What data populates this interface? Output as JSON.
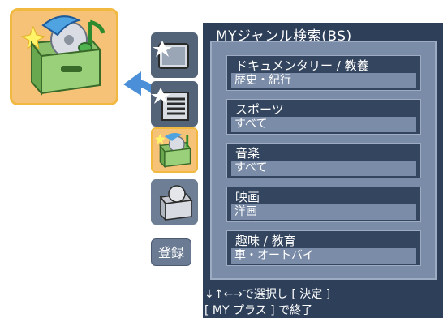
{
  "panel": {
    "title": "MYジャンル検索(BS)",
    "genres": [
      {
        "label": "ドキュメンタリー / 教養",
        "value": "歴史・紀行"
      },
      {
        "label": "スポーツ",
        "value": "すべて"
      },
      {
        "label": "音楽",
        "value": "すべて"
      },
      {
        "label": "映画",
        "value": "洋画"
      },
      {
        "label": "趣味 / 教育",
        "value": "車・オートバイ"
      }
    ]
  },
  "sidebar": {
    "register_label": "登録",
    "selected_index": 2
  },
  "footer": {
    "line1": "↓↑←→で選択し [ 決定 ]",
    "line2": "[ MY プラス ] で終了"
  },
  "colors": {
    "panel_bg": "#2e3f5a",
    "selected_tile": "#f6c278",
    "accent_border": "#f2b940"
  }
}
